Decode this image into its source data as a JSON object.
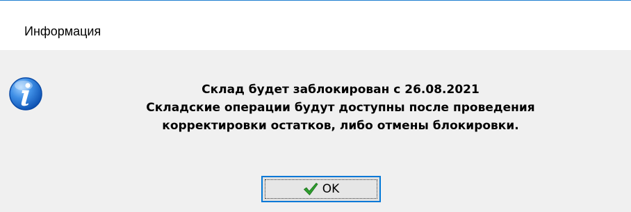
{
  "window": {
    "title": "Информация"
  },
  "message": {
    "lines": [
      "Склад будет заблокирован с 26.08.2021",
      "Складские операции будут доступны после проведения",
      "корректировки остатков, либо отмены блокировки."
    ]
  },
  "buttons": {
    "ok_label": "OK"
  },
  "icons": {
    "info": "info-icon",
    "check": "checkmark-icon"
  },
  "colors": {
    "title_border": "#1f7fd0",
    "dialog_bg": "#f0f0f0",
    "button_focus_border": "#0078d7",
    "check_green": "#2e9e2e",
    "info_blue": "#1e6fd0"
  }
}
